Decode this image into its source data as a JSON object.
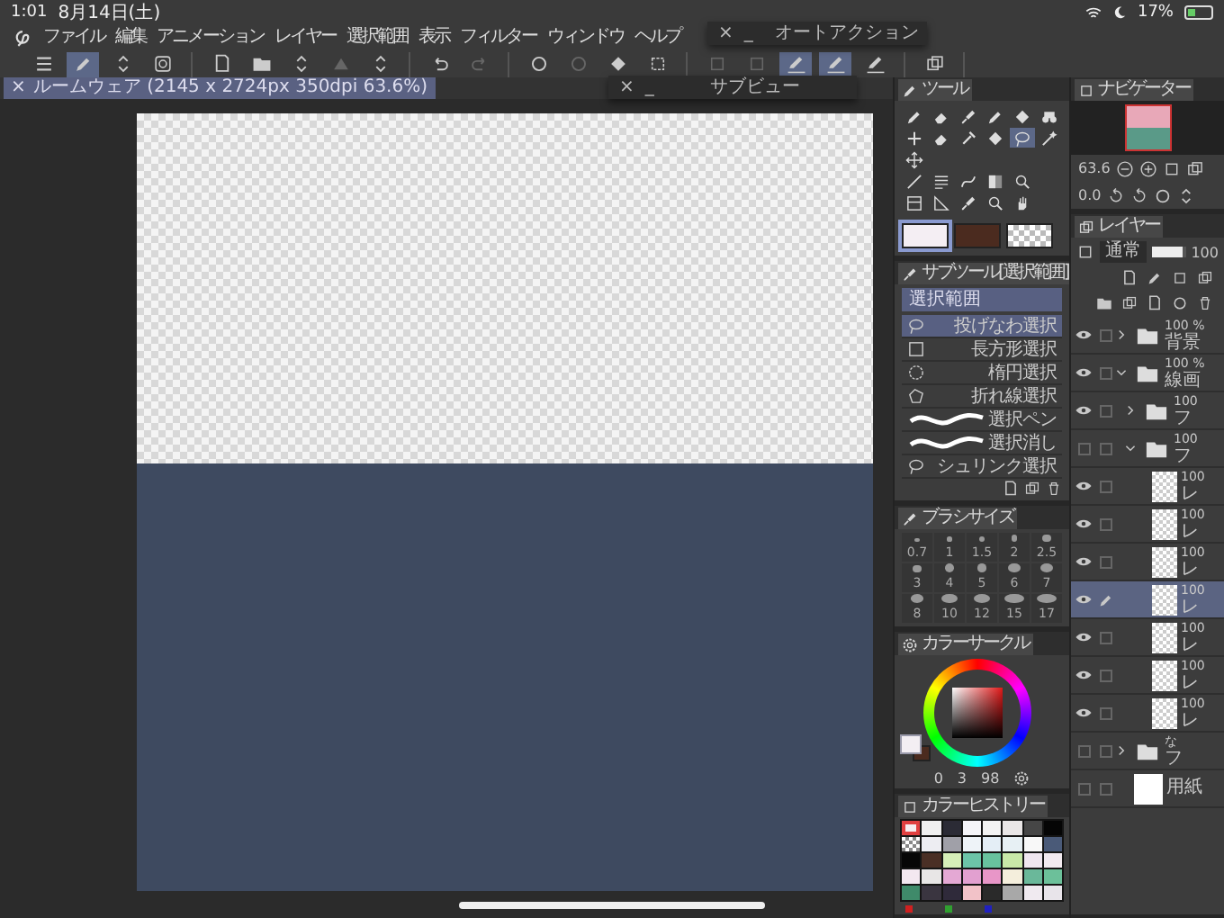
{
  "status_bar": {
    "time": "1:01",
    "date": "8月14日(土)",
    "battery": "17%"
  },
  "menu_bar": {
    "items": [
      "ファイル",
      "編集",
      "アニメーション",
      "レイヤー",
      "選択範囲",
      "表示",
      "フィルター",
      "ウィンドウ",
      "ヘルプ"
    ]
  },
  "toolbar": {
    "groups": [
      [
        {
          "kind": "menu",
          "selected": false,
          "disabled": false
        },
        {
          "kind": "pen",
          "selected": true,
          "disabled": false
        },
        {
          "kind": "updown",
          "selected": false,
          "disabled": false
        },
        {
          "kind": "gallery",
          "selected": false,
          "disabled": false
        }
      ],
      [
        {
          "kind": "doc",
          "selected": false,
          "disabled": false
        },
        {
          "kind": "folder",
          "selected": false,
          "disabled": false
        },
        {
          "kind": "updown",
          "selected": false,
          "disabled": false
        },
        {
          "kind": "triangle",
          "selected": false,
          "disabled": true
        },
        {
          "kind": "updown",
          "selected": false,
          "disabled": false
        }
      ],
      [
        {
          "kind": "undo",
          "selected": false,
          "disabled": false
        },
        {
          "kind": "redo",
          "selected": false,
          "disabled": true
        }
      ],
      [
        {
          "kind": "circle",
          "selected": false,
          "disabled": false
        },
        {
          "kind": "circle",
          "selected": false,
          "disabled": true
        },
        {
          "kind": "bucket",
          "selected": false,
          "disabled": false
        },
        {
          "kind": "crop",
          "selected": false,
          "disabled": false
        }
      ],
      [
        {
          "kind": "square",
          "selected": false,
          "disabled": true
        },
        {
          "kind": "square",
          "selected": false,
          "disabled": true
        },
        {
          "kind": "penline",
          "selected": true,
          "disabled": false
        },
        {
          "kind": "penline",
          "selected": true,
          "disabled": false
        },
        {
          "kind": "penline",
          "selected": false,
          "disabled": false
        }
      ],
      [
        {
          "kind": "layers",
          "selected": false,
          "disabled": false
        }
      ]
    ]
  },
  "auto_action_window": {
    "close": "×",
    "minimize": "_",
    "title": "オートアクション"
  },
  "sub_view_window": {
    "close": "×",
    "minimize": "_",
    "title": "サブビュー"
  },
  "document_tab": {
    "close": "×",
    "title": "ルームウェア (2145 x 2724px 350dpi 63.6%)"
  },
  "tool_panel": {
    "title": "ツール",
    "tool_rows": [
      [
        {
          "kind": "pen",
          "selected": false
        },
        {
          "kind": "eraser",
          "selected": false
        },
        {
          "kind": "brush",
          "selected": false
        },
        {
          "kind": "pen",
          "selected": false
        },
        {
          "kind": "bucket",
          "selected": false
        },
        {
          "kind": "binoculars",
          "selected": false
        }
      ],
      [
        {
          "kind": "cross",
          "selected": false
        },
        {
          "kind": "eraser",
          "selected": false
        },
        {
          "kind": "dropper",
          "selected": false
        },
        {
          "kind": "bucket",
          "selected": false
        },
        {
          "kind": "lasso",
          "selected": true
        },
        {
          "kind": "wand",
          "selected": false
        }
      ],
      [
        {
          "kind": "move",
          "selected": false
        }
      ],
      [
        {
          "kind": "line",
          "selected": false
        },
        {
          "kind": "textlines",
          "selected": false
        },
        {
          "kind": "curve",
          "selected": false
        },
        {
          "kind": "gradient",
          "selected": false
        },
        {
          "kind": "magnifier",
          "selected": false
        }
      ],
      [
        {
          "kind": "frame",
          "selected": false
        },
        {
          "kind": "ruler",
          "selected": false
        },
        {
          "kind": "brush",
          "selected": false
        },
        {
          "kind": "magnifier",
          "selected": false
        },
        {
          "kind": "hand",
          "selected": false
        }
      ]
    ],
    "color_chips": [
      {
        "kind": "color",
        "color": "#f4eef3",
        "selected": true
      },
      {
        "kind": "color",
        "color": "#4b2b1f",
        "selected": false
      },
      {
        "kind": "transparent",
        "selected": false
      }
    ]
  },
  "sub_tool_panel": {
    "title": "サブツール[選択範囲]",
    "group": "選択範囲",
    "items": [
      {
        "label": "投げなわ選択",
        "kind": "lasso",
        "selected": true
      },
      {
        "label": "長方形選択",
        "kind": "rect",
        "selected": false
      },
      {
        "label": "楕円選択",
        "kind": "ellipse",
        "selected": false
      },
      {
        "label": "折れ線選択",
        "kind": "polyline",
        "selected": false
      },
      {
        "label": "選択ペン",
        "kind": "stroke",
        "selected": false
      },
      {
        "label": "選択消し",
        "kind": "stroke",
        "selected": false
      },
      {
        "label": "シュリンク選択",
        "kind": "lasso",
        "selected": false
      }
    ]
  },
  "brush_size_panel": {
    "title": "ブラシサイズ",
    "sizes": [
      "0.7",
      "1",
      "1.5",
      "2",
      "2.5",
      "3",
      "4",
      "5",
      "6",
      "7",
      "8",
      "10",
      "12",
      "15",
      "17"
    ]
  },
  "color_circle_panel": {
    "title": "カラーサークル",
    "main_color": {
      "color": "#f3eef3"
    },
    "sub_color": {
      "color": "#4b2b1f"
    },
    "readings": [
      "0",
      "3",
      "98"
    ]
  },
  "color_history_panel": {
    "title": "カラーヒストリー",
    "swatches": [
      {
        "kind": "color",
        "color": "#f6eef0",
        "selected": true
      },
      {
        "kind": "color",
        "color": "#f0f0f0",
        "selected": false
      },
      {
        "kind": "color",
        "color": "#2b2b35",
        "selected": false
      },
      {
        "kind": "color",
        "color": "#f4f4f8",
        "selected": false
      },
      {
        "kind": "color",
        "color": "#f3f3f3",
        "selected": false
      },
      {
        "kind": "color",
        "color": "#e9e6e6",
        "selected": false
      },
      {
        "kind": "color",
        "color": "#464646",
        "selected": false
      },
      {
        "kind": "color",
        "color": "#050505",
        "selected": false
      },
      {
        "kind": "transparent",
        "selected": false
      },
      {
        "kind": "color",
        "color": "#ededf2",
        "selected": false
      },
      {
        "kind": "color",
        "color": "#a0a0a8",
        "selected": false
      },
      {
        "kind": "color",
        "color": "#eef3f8",
        "selected": false
      },
      {
        "kind": "color",
        "color": "#e4eef6",
        "selected": false
      },
      {
        "kind": "color",
        "color": "#e7f0f4",
        "selected": false
      },
      {
        "kind": "color",
        "color": "#f8f8f8",
        "selected": false
      },
      {
        "kind": "color",
        "color": "#4a5a78",
        "selected": false
      },
      {
        "kind": "color",
        "color": "#060606",
        "selected": false
      },
      {
        "kind": "color",
        "color": "#4a2f25",
        "selected": false
      },
      {
        "kind": "color",
        "color": "#d6efb8",
        "selected": false
      },
      {
        "kind": "color",
        "color": "#6cc4a8",
        "selected": false
      },
      {
        "kind": "color",
        "color": "#68c29e",
        "selected": false
      },
      {
        "kind": "color",
        "color": "#c8e8a8",
        "selected": false
      },
      {
        "kind": "color",
        "color": "#efe6ef",
        "selected": false
      },
      {
        "kind": "color",
        "color": "#f2eaf0",
        "selected": false
      },
      {
        "kind": "color",
        "color": "#f3e8f0",
        "selected": false
      },
      {
        "kind": "color",
        "color": "#e8e6e6",
        "selected": false
      },
      {
        "kind": "color",
        "color": "#e4a8d4",
        "selected": false
      },
      {
        "kind": "color",
        "color": "#e2a0d0",
        "selected": false
      },
      {
        "kind": "color",
        "color": "#e896c8",
        "selected": false
      },
      {
        "kind": "color",
        "color": "#f4eedc",
        "selected": false
      },
      {
        "kind": "color",
        "color": "#6ab89a",
        "selected": false
      },
      {
        "kind": "color",
        "color": "#6cc09a",
        "selected": false
      },
      {
        "kind": "color",
        "color": "#3f8a6a",
        "selected": false
      },
      {
        "kind": "color",
        "color": "#3a3540",
        "selected": false
      },
      {
        "kind": "color",
        "color": "#2f2a3a",
        "selected": false
      },
      {
        "kind": "color",
        "color": "#f2c2c8",
        "selected": false
      },
      {
        "kind": "color",
        "color": "#2a2a2a",
        "selected": false
      },
      {
        "kind": "color",
        "color": "#a8a8a8",
        "selected": false
      },
      {
        "kind": "color",
        "color": "#f0eaf0",
        "selected": false
      },
      {
        "kind": "color",
        "color": "#e8e4ea",
        "selected": false
      }
    ],
    "channel_marks": [
      {
        "color": "#d02020"
      },
      {
        "color": "#30a030"
      },
      {
        "color": "#2020c0"
      }
    ]
  },
  "navigator_panel": {
    "title": "ナビゲーター",
    "zoom": "63.6",
    "angle": "0.0"
  },
  "layer_panel": {
    "title": "レイヤー",
    "blend_mode": "通常",
    "opacity": "100",
    "opacity_slider": {
      "level": 0.9
    },
    "layers": [
      {
        "kind": "folder",
        "opacity": "100 %",
        "name": "背景",
        "visible": true,
        "selected": false,
        "expanded": false
      },
      {
        "kind": "folder",
        "opacity": "100 %",
        "name": "線画",
        "visible": true,
        "selected": false,
        "expanded": true,
        "children": [
          {
            "kind": "folder",
            "opacity": "100",
            "name": "フ",
            "visible": true,
            "selected": false,
            "expanded": false
          },
          {
            "kind": "folder",
            "opacity": "100",
            "name": "フ",
            "visible": false,
            "selected": false,
            "expanded": true,
            "children": [
              {
                "kind": "layer",
                "opacity": "100",
                "name": "レ",
                "visible": true,
                "selected": false
              },
              {
                "kind": "layer",
                "opacity": "100",
                "name": "レ",
                "visible": true,
                "selected": false
              },
              {
                "kind": "layer",
                "opacity": "100",
                "name": "レ",
                "visible": true,
                "selected": false
              },
              {
                "kind": "layer",
                "opacity": "100",
                "name": "レ",
                "visible": true,
                "selected": true
              },
              {
                "kind": "layer",
                "opacity": "100",
                "name": "レ",
                "visible": true,
                "selected": false
              },
              {
                "kind": "layer",
                "opacity": "100",
                "name": "レ",
                "visible": true,
                "selected": false
              },
              {
                "kind": "layer",
                "opacity": "100",
                "name": "レ",
                "visible": true,
                "selected": false
              }
            ]
          }
        ]
      },
      {
        "kind": "folder",
        "opacity": "な",
        "name": "フ",
        "visible": false,
        "selected": false,
        "expanded": false
      },
      {
        "kind": "paper",
        "name": "用紙",
        "visible": false,
        "selected": false
      }
    ]
  }
}
